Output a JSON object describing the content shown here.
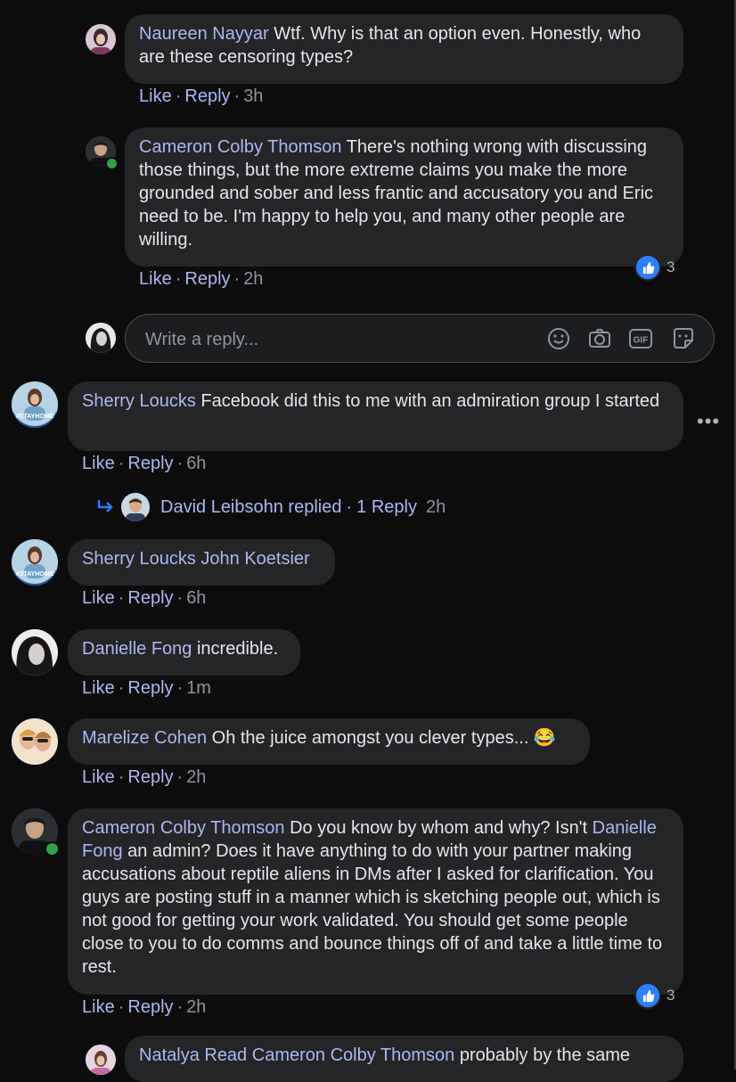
{
  "comments": [
    {
      "name": "Naureen Nayyar",
      "text": "Wtf. Why is that an option even. Honestly, who are these censoring types?",
      "like": "Like",
      "reply": "Reply",
      "time": "3h"
    },
    {
      "name": "Cameron Colby Thomson",
      "text": "There's nothing wrong with discussing those things, but the more extreme claims you make the more grounded and sober and less frantic and accusatory you and Eric need to be. I'm happy to help you, and many other people are willing.",
      "like": "Like",
      "reply": "Reply",
      "time": "2h",
      "reaction_count": "3"
    },
    {
      "name": "Sherry Loucks",
      "text": "Facebook did this to me with an admiration group I started",
      "like": "Like",
      "reply": "Reply",
      "time": "6h",
      "avatar_badge": "#STAYHOME"
    },
    {
      "name": "Sherry Loucks",
      "mention": "John Koetsier",
      "like": "Like",
      "reply": "Reply",
      "time": "6h",
      "avatar_badge": "#STAYHOME"
    },
    {
      "name": "Danielle Fong",
      "text": "incredible.",
      "like": "Like",
      "reply": "Reply",
      "time": "1m"
    },
    {
      "name": "Marelize Cohen",
      "text": "Oh the juice amongst you clever types... 😂",
      "like": "Like",
      "reply": "Reply",
      "time": "2h"
    },
    {
      "name": "Cameron Colby Thomson",
      "text_before": "Do you know by whom and why? Isn't",
      "mention": "Danielle Fong",
      "text_after": "an admin? Does it have anything to do with your partner making accusations about reptile aliens in DMs after I asked for clarification. You guys are posting stuff in a manner which is sketching people out, which is not good for getting your work validated. You should get some people close to you to do comms and bounce things off of and take a little time to rest.",
      "like": "Like",
      "reply": "Reply",
      "time": "2h",
      "reaction_count": "3"
    },
    {
      "name": "Natalya Read",
      "mention": "Cameron Colby Thomson",
      "text": "probably by the same"
    }
  ],
  "reply_box": {
    "placeholder": "Write a reply...",
    "icons": [
      "emoji-icon",
      "camera-icon",
      "gif-icon",
      "sticker-icon"
    ],
    "gif_label": "GIF"
  },
  "replied_summary": {
    "text": "David Leibsohn replied",
    "separator": "·",
    "count": "1 Reply",
    "time": "2h"
  },
  "separator": "·",
  "colors": {
    "background": "#0c0c0d",
    "bubble": "#242526",
    "name": "#aab8f2",
    "meta": "#8d949e",
    "like_badge": "#2d7ff9",
    "online": "#31a24c"
  }
}
